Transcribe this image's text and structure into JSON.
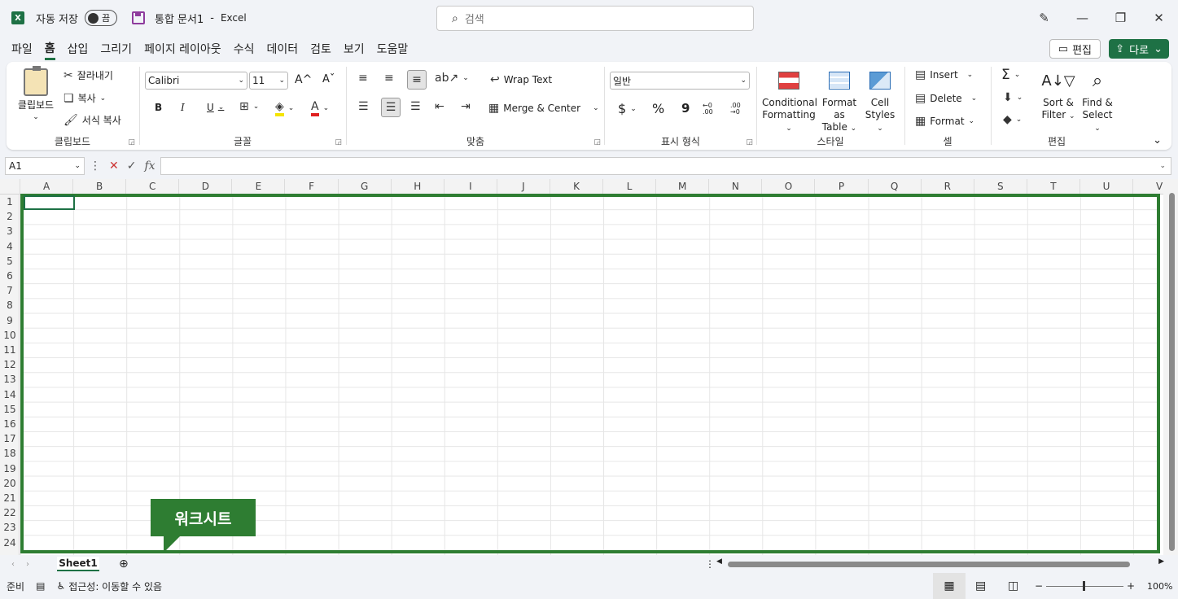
{
  "titlebar": {
    "app_logo": "X",
    "autosave_label": "자동 저장",
    "autosave_state": "끔",
    "doc_name": "통합 문서1",
    "separator": "-",
    "app_name": "Excel",
    "search_placeholder": "검색"
  },
  "menu": {
    "tabs": [
      "파일",
      "홈",
      "삽입",
      "그리기",
      "페이지 레이아웃",
      "수식",
      "데이터",
      "검토",
      "보기",
      "도움말"
    ],
    "active_tab": "홈",
    "edit_label": "편집",
    "share_label": "다로"
  },
  "ribbon": {
    "clipboard": {
      "paste": "클립보드",
      "cut": "잘라내기",
      "copy": "복사",
      "format_painter": "서식 복사",
      "group_label": "클립보드"
    },
    "font": {
      "font_name": "Calibri",
      "font_size": "11",
      "grow": "A^",
      "shrink": "Aˇ",
      "bold": "B",
      "italic": "I",
      "underline": "U",
      "group_label": "글꼴",
      "fill_color": "#f5e400",
      "font_color": "#e02020"
    },
    "alignment": {
      "wrap_text": "Wrap Text",
      "merge_center": "Merge & Center",
      "group_label": "맞춤"
    },
    "number": {
      "format": "일반",
      "currency": "$",
      "percent": "%",
      "comma": "9",
      "inc_decimal": "←0 .00",
      "dec_decimal": ".00 →0",
      "group_label": "표시 형식"
    },
    "styles": {
      "conditional": [
        "Conditional",
        "Formatting"
      ],
      "format_table": [
        "Format as",
        "Table"
      ],
      "cell_styles": [
        "Cell",
        "Styles"
      ],
      "group_label": "스타일"
    },
    "cells": {
      "insert": "Insert",
      "delete": "Delete",
      "format": "Format",
      "group_label": "셀"
    },
    "editing": {
      "sort_filter": [
        "Sort &",
        "Filter"
      ],
      "find_select": [
        "Find &",
        "Select"
      ],
      "group_label": "편집"
    }
  },
  "formula_bar": {
    "name_box": "A1",
    "fx": "fx"
  },
  "grid": {
    "columns": [
      "A",
      "B",
      "C",
      "D",
      "E",
      "F",
      "G",
      "H",
      "I",
      "J",
      "K",
      "L",
      "M",
      "N",
      "O",
      "P",
      "Q",
      "R",
      "S",
      "T",
      "U",
      "V"
    ],
    "rows": [
      "1",
      "2",
      "3",
      "4",
      "5",
      "6",
      "7",
      "8",
      "9",
      "10",
      "11",
      "12",
      "13",
      "14",
      "15",
      "16",
      "17",
      "18",
      "19",
      "20",
      "21",
      "22",
      "23",
      "24"
    ],
    "active_cell": "A1"
  },
  "callout": {
    "label": "워크시트",
    "color": "#2e7d32"
  },
  "sheets": {
    "tabs": [
      "Sheet1"
    ],
    "active": "Sheet1"
  },
  "status": {
    "ready": "준비",
    "accessibility": "접근성: 이동할 수 있음",
    "zoom": "100%"
  },
  "colors": {
    "brand": "#1e7145"
  }
}
